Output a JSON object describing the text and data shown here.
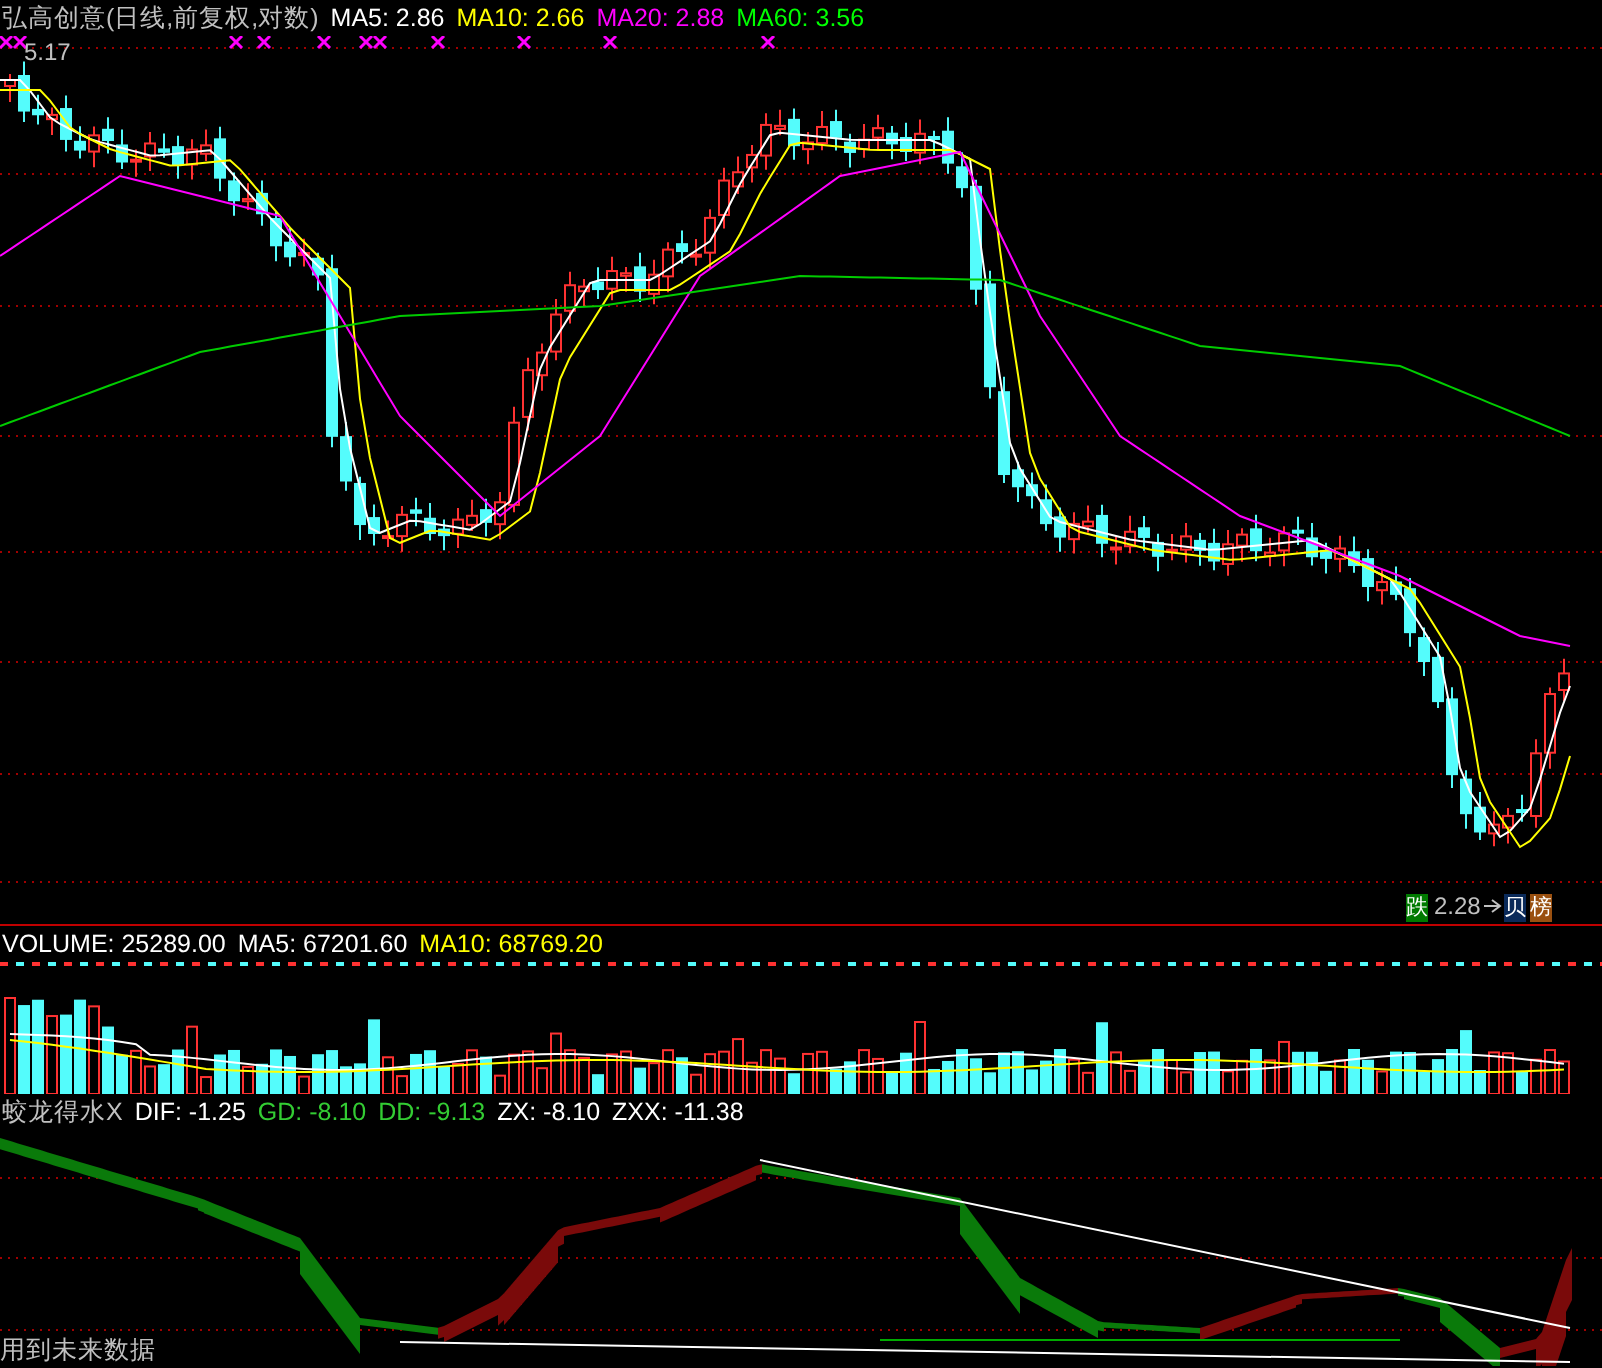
{
  "header": {
    "title": "弘高创意(日线,前复权,对数)",
    "indicators": [
      {
        "label": "MA5: 2.86",
        "color": "#ffffff"
      },
      {
        "label": "MA10: 2.66",
        "color": "#ffff00"
      },
      {
        "label": "MA20: 2.88",
        "color": "#ff00ff"
      },
      {
        "label": "MA60: 3.56",
        "color": "#00ff00"
      }
    ]
  },
  "price_panel": {
    "high_label": "5.17",
    "low_label": "2.28",
    "badges": [
      {
        "text": "跌",
        "color": "#007a00"
      },
      {
        "text": "贝",
        "color": "#0a2a5a"
      },
      {
        "text": "榜",
        "color": "#9a5010"
      }
    ]
  },
  "volume_panel": {
    "indicators": [
      {
        "label": "VOLUME: 25289.00",
        "color": "#ffffff"
      },
      {
        "label": "MA5: 67201.60",
        "color": "#ffffff"
      },
      {
        "label": "MA10: 68769.20",
        "color": "#ffff00"
      }
    ]
  },
  "indicator_panel": {
    "name": "蛟龙得水X",
    "indicators": [
      {
        "label": "DIF: -1.25",
        "color": "#ffffff"
      },
      {
        "label": "GD: -8.10",
        "color": "#33cc33"
      },
      {
        "label": "DD: -9.13",
        "color": "#33cc33"
      },
      {
        "label": "ZX: -8.10",
        "color": "#ffffff"
      },
      {
        "label": "ZXX: -11.38",
        "color": "#ffffff"
      }
    ]
  },
  "footer_note": "用到未来数据"
}
